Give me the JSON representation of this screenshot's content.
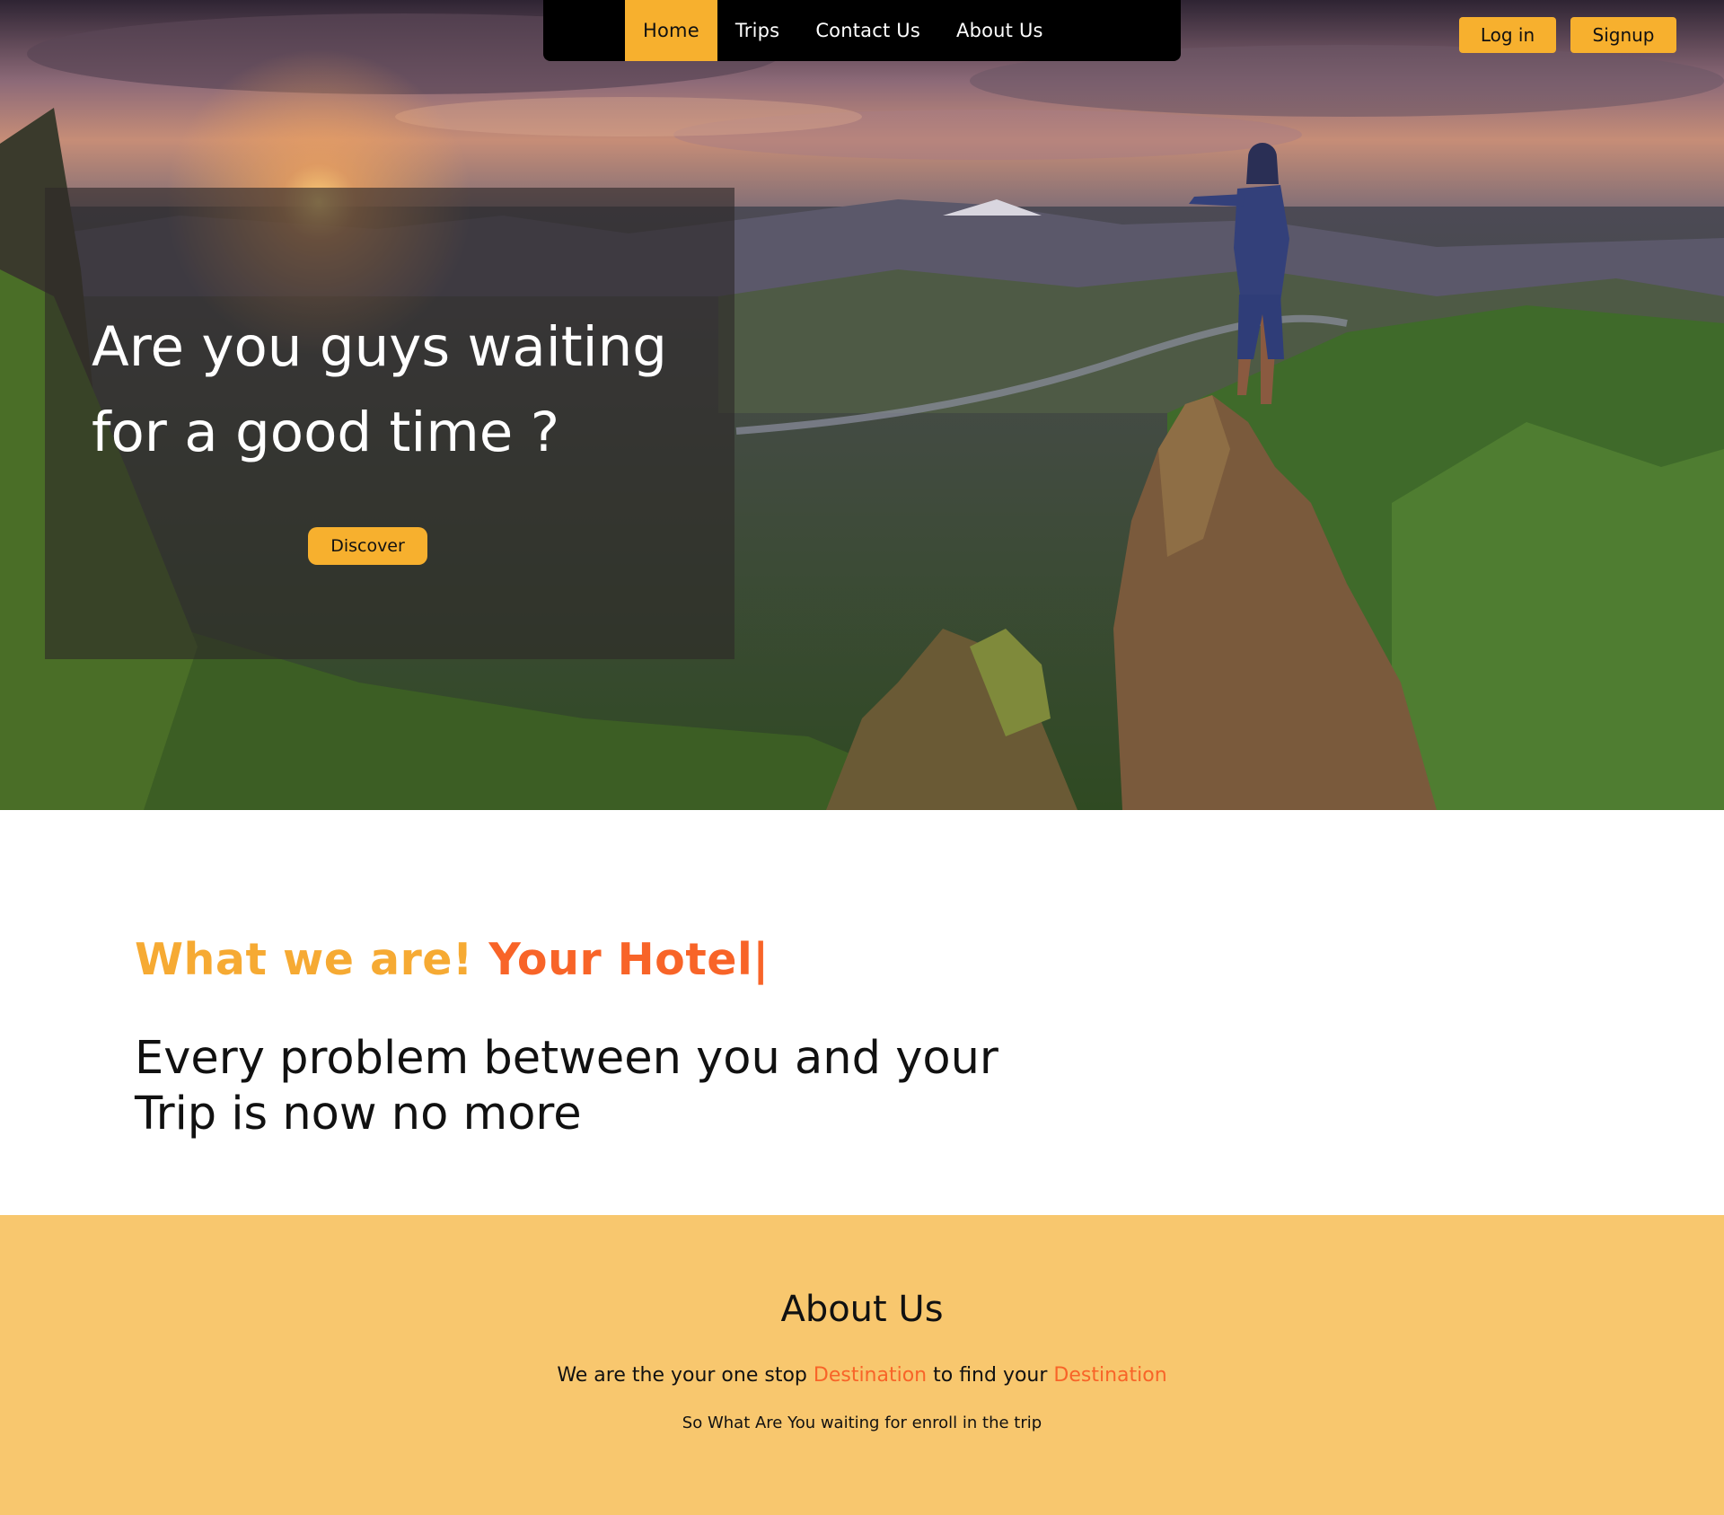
{
  "nav": {
    "items": [
      {
        "label": "Home",
        "active": true
      },
      {
        "label": "Trips",
        "active": false
      },
      {
        "label": "Contact Us",
        "active": false
      },
      {
        "label": "About Us",
        "active": false
      }
    ]
  },
  "auth": {
    "login_label": "Log in",
    "signup_label": "Signup"
  },
  "hero": {
    "title_line1": "Are you guys waiting",
    "title_line2": "for a good time ?",
    "discover_label": "Discover"
  },
  "intro": {
    "prefix": "What we are!",
    "typed": "Your Hotel|",
    "headline_line1": "Every problem between you and your",
    "headline_line2": "Trip is now no more"
  },
  "about": {
    "title": "About Us",
    "line_part1": "We are the your one stop ",
    "line_highlight1": "Destination",
    "line_part2": " to find your ",
    "line_highlight2": "Destination",
    "subline": "So What Are You waiting for enroll in the trip"
  },
  "colors": {
    "accent": "#f7b02e",
    "highlight": "#f86428",
    "about_bg": "#f8c76e",
    "nav_bg": "#000000"
  }
}
